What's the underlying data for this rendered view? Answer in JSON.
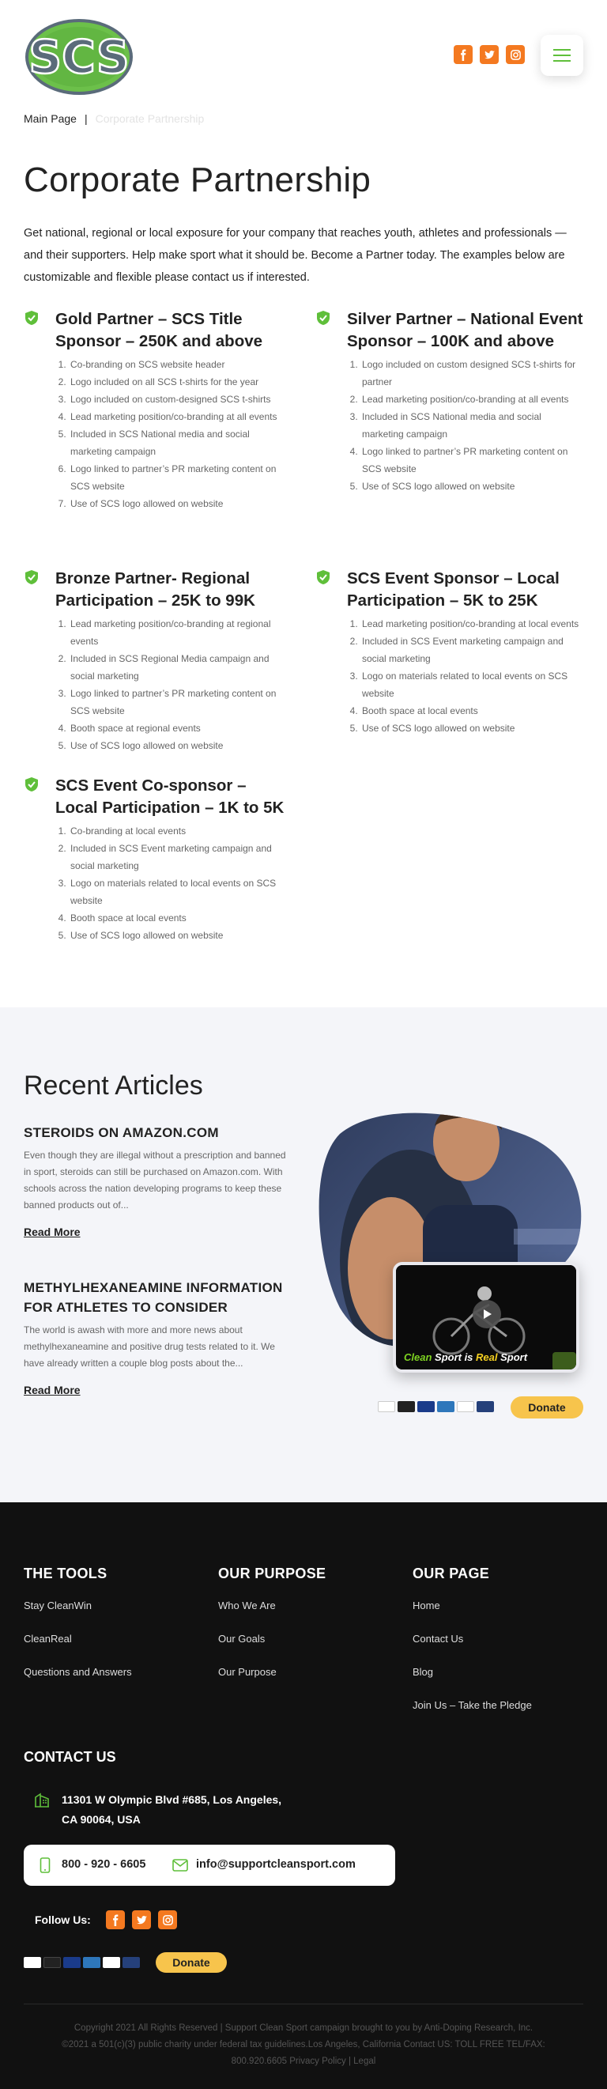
{
  "header": {
    "logo_text": "SCS",
    "social": [
      {
        "name": "facebook",
        "icon": "facebook-icon"
      },
      {
        "name": "twitter",
        "icon": "twitter-icon"
      },
      {
        "name": "instagram",
        "icon": "instagram-icon"
      }
    ],
    "menu_icon": "hamburger-icon"
  },
  "breadcrumb": {
    "home": "Main Page",
    "separator": "|",
    "current": "Corporate Partnership"
  },
  "page": {
    "title": "Corporate Partnership",
    "intro": "Get national, regional or local exposure for your company that reaches youth, athletes and professionals — and their supporters. Help make sport what it should be. Become a Partner today. The examples below are customizable and flexible please contact us if interested."
  },
  "tiers": [
    {
      "title": "Gold Partner – SCS Title Sponsor – 250K and above",
      "items": [
        "Co-branding on SCS website header",
        "Logo included on all SCS t-shirts for the year",
        "Logo included on custom-designed SCS t-shirts",
        "Lead marketing position/co-branding at all events",
        "Included in SCS National media and social marketing campaign",
        "Logo linked to partner’s PR marketing content on SCS website",
        "Use of SCS logo allowed on website"
      ]
    },
    {
      "title": "Silver Partner – National Event Sponsor – 100K and above",
      "items": [
        "Logo included on custom designed SCS t-shirts for partner",
        "Lead marketing position/co-branding at all events",
        "Included in SCS National media and social marketing campaign",
        "Logo linked to partner’s PR marketing content on SCS website",
        "Use of SCS logo allowed on website"
      ]
    },
    {
      "title": "Bronze Partner- Regional Participation – 25K to 99K",
      "items": [
        "Lead marketing position/co-branding at regional events",
        "Included in SCS Regional Media campaign and social marketing",
        "Logo linked to partner’s PR marketing content on SCS website",
        "Booth space at regional events",
        "Use of SCS logo allowed on website"
      ]
    },
    {
      "title": "SCS Event Sponsor – Local Participation – 5K to 25K",
      "items": [
        "Lead marketing position/co-branding at local events",
        "Included in SCS Event marketing campaign and social marketing",
        "Logo on materials related to local events on SCS website",
        "Booth space at local events",
        "Use of SCS logo allowed on website"
      ]
    },
    {
      "title": "SCS Event Co-sponsor – Local Participation – 1K to 5K",
      "items": [
        "Co-branding at local events",
        "Included in SCS Event marketing campaign and social marketing",
        "Logo on materials related to local events on SCS website",
        "Booth space at local events",
        "Use of SCS logo allowed on website"
      ]
    }
  ],
  "articles": {
    "heading": "Recent Articles",
    "items": [
      {
        "title": "STEROIDS ON AMAZON.COM",
        "excerpt": "Even though they are illegal without a prescription and banned in sport, steroids can still be purchased on Amazon.com. With schools across the nation developing programs to keep these banned products out of...",
        "link": "Read More"
      },
      {
        "title": "METHYLHEXANEAMINE INFORMATION FOR ATHLETES TO CONSIDER",
        "excerpt": "The world is awash with more and more news about methylhexaneamine and positive drug tests related to it.  We have already written a couple blog posts about the...",
        "link": "Read More"
      }
    ],
    "video": {
      "caption_clean": "Clean",
      "caption_sport1": " Sport is ",
      "caption_real": "Real",
      "caption_sport2": " Sport",
      "play_icon": "play-icon"
    },
    "donate_label": "Donate",
    "payment_cards": [
      "visa",
      "mastercard",
      "maestro",
      "amex",
      "discover",
      "card"
    ]
  },
  "footer": {
    "tools": {
      "title": "THE TOOLS",
      "links": [
        "Stay CleanWin",
        "CleanReal",
        "Questions and Answers"
      ]
    },
    "purpose": {
      "title": "OUR PURPOSE",
      "links": [
        "Who We Are",
        "Our Goals",
        "Our Purpose"
      ]
    },
    "page": {
      "title": "OUR PAGE",
      "links": [
        "Home",
        "Contact Us",
        "Blog",
        "Join Us – Take the Pledge"
      ]
    },
    "contact": {
      "title": "CONTACT US",
      "address_line1": "11301 W Olympic Blvd #685, Los Angeles,",
      "address_line2": "CA 90064, USA",
      "phone": "800 - 920 - 6605",
      "email": "info@supportcleansport.com"
    },
    "follow_label": "Follow Us:",
    "donate_label": "Donate",
    "copyright_line1": "Copyright 2021 All Rights Reserved | Support Clean Sport campaign brought to you by Anti-Doping Research, Inc.",
    "copyright_line2": "©2021 a 501(c)(3) public charity under federal tax guidelines.Los Angeles, California Contact US: TOLL FREE TEL/FAX:",
    "copyright_line3": "800.920.6605 Privacy Policy | Legal"
  },
  "colors": {
    "accent_green": "#5fbf3a",
    "social_orange": "#f47920",
    "donate_yellow": "#f7c44c",
    "footer_bg": "#111111",
    "articles_bg": "#f4f5f9"
  }
}
